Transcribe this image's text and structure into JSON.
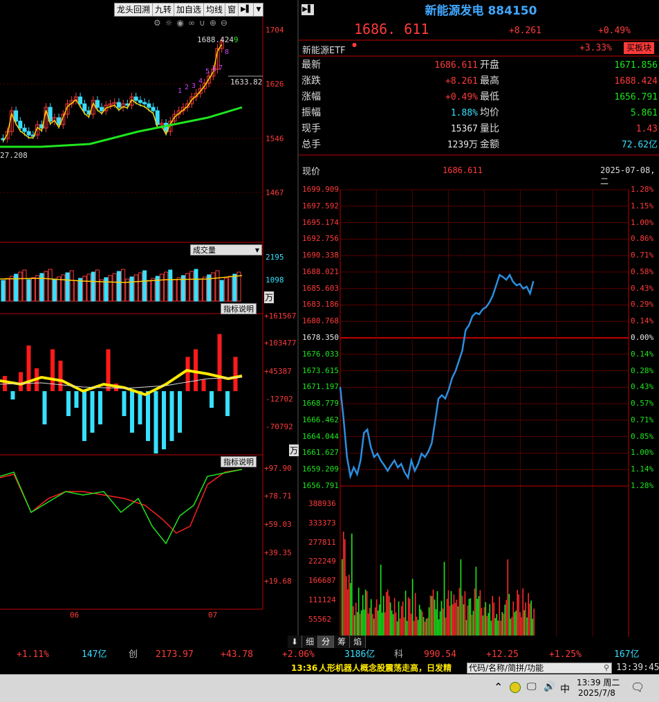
{
  "left_toolbar": {
    "items": [
      "龙头回溯",
      "九转",
      "加自选",
      "均线",
      "窗"
    ]
  },
  "kline": {
    "price_ticks": [
      "1704",
      "1626",
      "1546",
      "1467"
    ],
    "high_label": "1688.424",
    "high_marker": "9",
    "close_label": "1633.82",
    "low_label": "27.208",
    "nine_count": [
      "1",
      "2",
      "3",
      "4",
      "5",
      "6",
      "7",
      "8"
    ]
  },
  "volume_panel": {
    "tag": "成交量",
    "ticks": [
      "2195",
      "1098"
    ],
    "unit": "万"
  },
  "macd_panel": {
    "tag": "指标说明",
    "ticks": [
      "+161567",
      "+103477",
      "+45387",
      "-12702",
      "-70792"
    ],
    "unit": "万"
  },
  "kdj_panel": {
    "tag": "指标说明",
    "ticks": [
      "+97.90",
      "+78.71",
      "+59.03",
      "+39.35",
      "+19.68"
    ],
    "months": [
      "06",
      "07"
    ]
  },
  "quote": {
    "title": "新能源发电 884150",
    "price": "1686. 611",
    "change": "+8.261",
    "change_pct": "+0.49%",
    "etf_label": "新能源ETF",
    "etf_pct": "+3.33%",
    "buy_sector": "买板块",
    "rows": [
      {
        "l1": "最新",
        "v1": "1686.611",
        "c1": "red",
        "l2": "开盘",
        "v2": "1671.856",
        "c2": "green"
      },
      {
        "l1": "涨跌",
        "v1": "+8.261",
        "c1": "red",
        "l2": "最高",
        "v2": "1688.424",
        "c2": "red"
      },
      {
        "l1": "涨幅",
        "v1": "+0.49%",
        "c1": "red",
        "l2": "最低",
        "v2": "1656.791",
        "c2": "green"
      },
      {
        "l1": "振幅",
        "v1": "1.88%",
        "c1": "cyan",
        "l2": "均价",
        "v2": "5.861",
        "c2": "green"
      },
      {
        "l1": "现手",
        "v1": "15367",
        "c1": "white",
        "l2": "量比",
        "v2": "1.43",
        "c2": "red"
      },
      {
        "l1": "总手",
        "v1": "1239万",
        "c1": "white",
        "l2": "金额",
        "v2": "72.62亿",
        "c2": "cyan"
      }
    ],
    "current_label": "现价",
    "current_value": "1686.611",
    "date": "2025-07-08,二"
  },
  "chart_data": {
    "type": "line",
    "title": "",
    "prev_close": 1678.35,
    "ylim": [
      1656.791,
      1699.909
    ],
    "left_ticks": [
      "1699.909",
      "1697.592",
      "1695.174",
      "1692.756",
      "1690.338",
      "1688.021",
      "1685.603",
      "1683.186",
      "1680.768",
      "1678.350",
      "1676.033",
      "1673.615",
      "1671.197",
      "1668.779",
      "1666.462",
      "1664.044",
      "1661.627",
      "1659.209",
      "1656.791"
    ],
    "right_ticks": [
      "1.28%",
      "1.15%",
      "1.00%",
      "0.86%",
      "0.71%",
      "0.58%",
      "0.43%",
      "0.29%",
      "0.14%",
      "0.00%",
      "0.14%",
      "0.28%",
      "0.43%",
      "0.57%",
      "0.71%",
      "0.85%",
      "1.00%",
      "1.14%",
      "1.28%"
    ],
    "series": [
      {
        "values": [
          1671.2,
          1666.5,
          1661.0,
          1658.2,
          1659.5,
          1658.5,
          1660.5,
          1664.5,
          1665.0,
          1662.5,
          1661.0,
          1661.5,
          1660.5,
          1659.8,
          1659.0,
          1659.8,
          1660.5,
          1659.5,
          1660.0,
          1658.8,
          1658.0,
          1660.5,
          1659.0,
          1660.0,
          1661.5,
          1661.0,
          1661.8,
          1663.0,
          1666.2,
          1669.5,
          1670.0,
          1669.5,
          1670.8,
          1672.5,
          1673.5,
          1675.0,
          1676.5,
          1679.5,
          1680.2,
          1681.5,
          1682.0,
          1681.8,
          1682.5,
          1682.8,
          1683.5,
          1684.5,
          1686.0,
          1687.5,
          1687.2,
          1686.8,
          1687.5,
          1686.5,
          1686.0,
          1686.2,
          1685.5,
          1685.8,
          1684.8,
          1686.6
        ]
      }
    ],
    "volume_ticks": [
      "388936",
      "333373",
      "277811",
      "222249",
      "166687",
      "111124",
      "55562"
    ]
  },
  "bottom_tabs": [
    "细",
    "分",
    "筹",
    "焰"
  ],
  "index_bar": {
    "items": [
      {
        "text": "+1.11%",
        "color": "red"
      },
      {
        "text": "147亿",
        "color": "cyan"
      },
      {
        "text": "创",
        "color": "gray"
      },
      {
        "text": "2173.97",
        "color": "red"
      },
      {
        "text": "+43.78",
        "color": "red"
      },
      {
        "text": "+2.06%",
        "color": "red"
      },
      {
        "text": "3186亿",
        "color": "cyan"
      },
      {
        "text": "科",
        "color": "gray"
      },
      {
        "text": "990.54",
        "color": "red"
      },
      {
        "text": "+12.25",
        "color": "red"
      },
      {
        "text": "+1.25%",
        "color": "red"
      },
      {
        "text": "167亿",
        "color": "cyan"
      }
    ]
  },
  "news": {
    "time": "13:36",
    "text": "人形机器人概念股震荡走高，日发精",
    "search_placeholder": "代码/名称/简拼/功能",
    "clock": "13:39:45"
  },
  "taskbar": {
    "ime": "中",
    "time": "13:39 周二",
    "date": "2025/7/8"
  }
}
